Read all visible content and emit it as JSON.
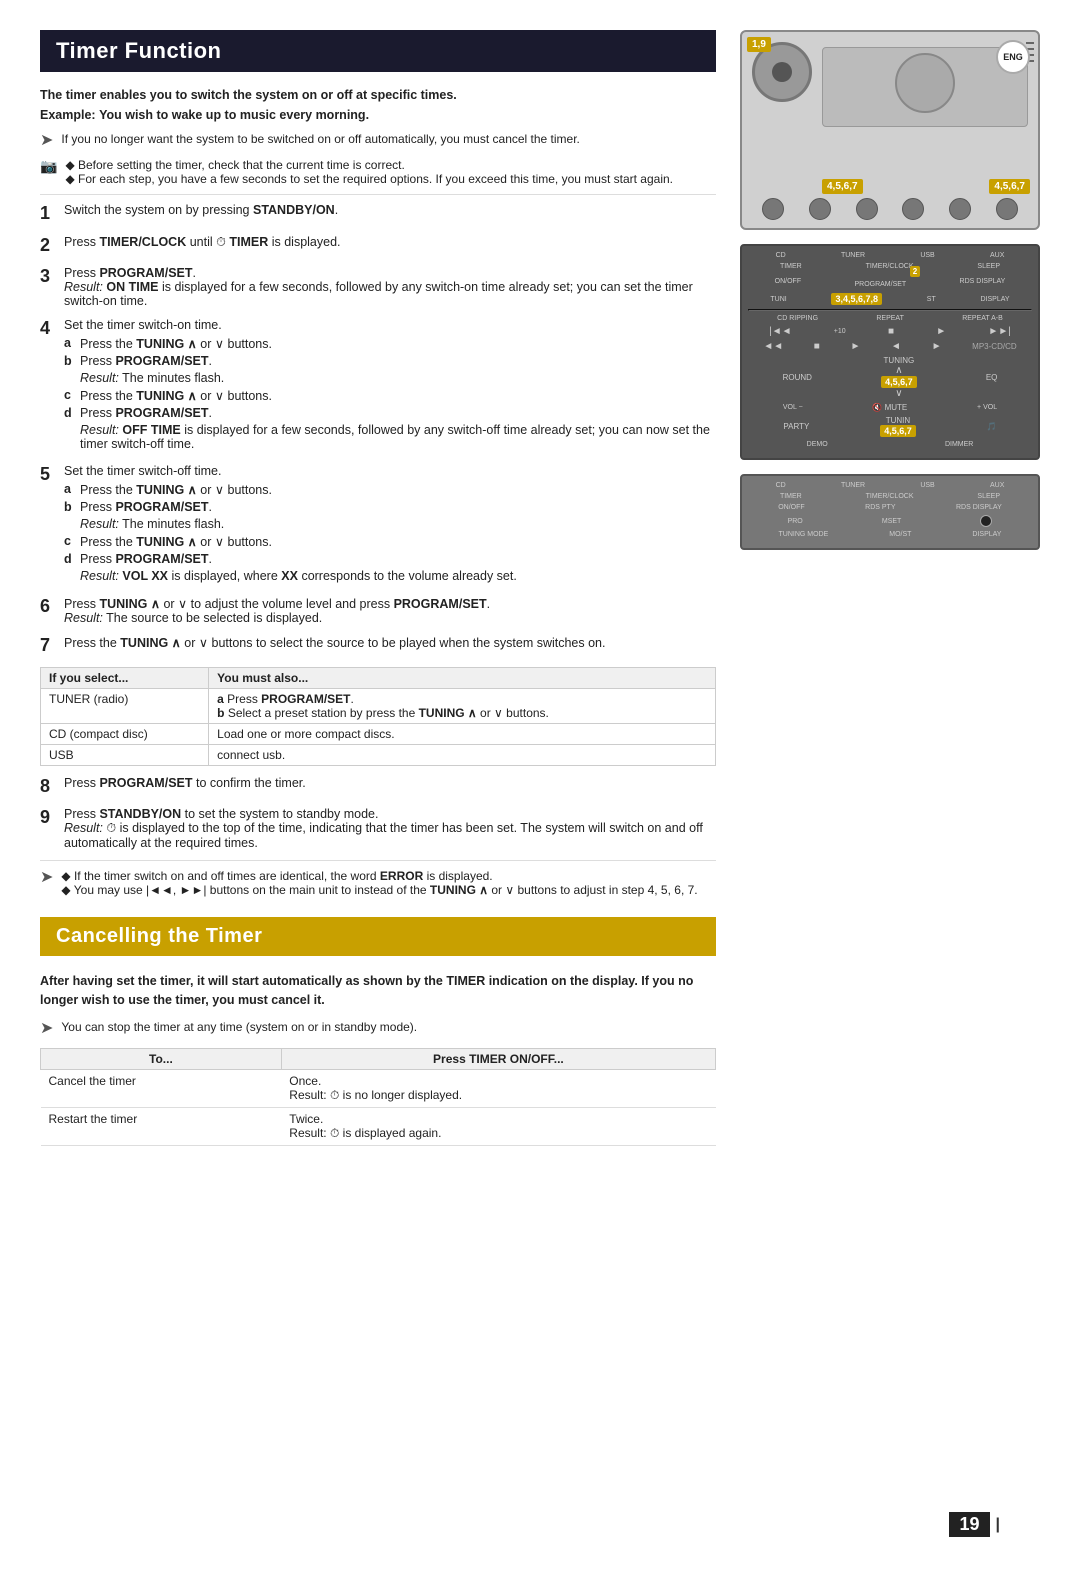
{
  "page": {
    "number": "19",
    "lang_badge": "ENG"
  },
  "timer_section": {
    "title": "Timer Function",
    "intro_bold": "The timer enables you to switch the system on or off at specific times.",
    "intro_example_label": "Example:",
    "intro_example_text": "You wish to wake up to music every morning.",
    "note1": "If you no longer want the system to be switched on or off automatically, you must cancel the timer.",
    "note2a": "◆ Before setting the timer, check that the current time is correct.",
    "note2b": "◆ For each step, you have a few seconds to set the required options. If you exceed this time, you must start again.",
    "steps": [
      {
        "num": "1",
        "text": "Switch the system on by pressing ",
        "bold": "STANDBY/ON",
        "after": "."
      },
      {
        "num": "2",
        "text": "Press ",
        "bold": "TIMER/CLOCK",
        "middle": " until ",
        "icon": "⏱",
        "after_bold": "TIMER",
        "after": " is displayed."
      },
      {
        "num": "3",
        "text": "Press ",
        "bold": "PROGRAM/SET",
        "after": ".",
        "result": "Result:",
        "result_text": " ON TIME is displayed for a few seconds, followed by any switch-on time already set; you can set the timer switch-on time."
      },
      {
        "num": "4",
        "text": "Set the timer switch-on time.",
        "substeps": [
          {
            "letter": "a",
            "text": "Press the ",
            "bold": "TUNING ∧",
            "after": " or ∨ buttons."
          },
          {
            "letter": "b",
            "text": "Press ",
            "bold": "PROGRAM/SET",
            "after": "."
          },
          {
            "letter": "",
            "text": "Result: The minutes flash."
          },
          {
            "letter": "c",
            "text": "Press the ",
            "bold": "TUNING ∧",
            "after": " or ∨ buttons."
          },
          {
            "letter": "d",
            "text": "Press ",
            "bold": "PROGRAM/SET",
            "after": "."
          },
          {
            "letter": "",
            "text": "Result: OFF TIME is displayed for a few seconds, followed by any switch-off time already set; you can now set the timer switch-off time."
          }
        ]
      },
      {
        "num": "5",
        "text": "Set the timer switch-off time.",
        "substeps": [
          {
            "letter": "a",
            "text": "Press the ",
            "bold": "TUNING ∧",
            "after": " or ∨ buttons."
          },
          {
            "letter": "b",
            "text": "Press ",
            "bold": "PROGRAM/SET",
            "after": "."
          },
          {
            "letter": "",
            "text": "Result: The minutes flash."
          },
          {
            "letter": "c",
            "text": "Press the ",
            "bold": "TUNING ∧",
            "after": " or ∨ buttons."
          },
          {
            "letter": "d",
            "text": "Press ",
            "bold": "PROGRAM/SET",
            "after": "."
          },
          {
            "letter": "",
            "text": "Result: VOL XX is displayed, where XX corresponds to the volume already set."
          }
        ]
      },
      {
        "num": "6",
        "text": "Press ",
        "bold": "TUNING ∧",
        "after": " or ∨ to adjust the volume level and press ",
        "bold2": "PROGRAM/SET",
        "after2": ".",
        "result": "Result:",
        "result_text": " The source to be selected is displayed."
      },
      {
        "num": "7",
        "text": "Press the ",
        "bold": "TUNING ∧",
        "after": " or ∨ buttons to select the source to be played when the system switches on."
      }
    ],
    "select_table": {
      "headers": [
        "If you select...",
        "You must also..."
      ],
      "rows": [
        {
          "col1": "TUNER (radio)",
          "col2_items": [
            {
              "letter": "a",
              "text": "Press ",
              "bold": "PROGRAM/SET",
              "after": "."
            },
            {
              "letter": "b",
              "text": "Select a preset station by press the ",
              "bold": "TUNING ∧",
              "after": " or ∨ buttons."
            }
          ]
        },
        {
          "col1": "CD (compact disc)",
          "col2": "Load one or more compact discs."
        },
        {
          "col1": "USB",
          "col2": "connect usb."
        }
      ]
    },
    "step8": {
      "num": "8",
      "text": "Press ",
      "bold": "PROGRAM/SET",
      "after": " to confirm the timer."
    },
    "step9": {
      "num": "9",
      "text": "Press ",
      "bold": "STANDBY/ON",
      "after": " to set the system to standby mode.",
      "result": "Result:",
      "result_text": " ⏱ is displayed to the top of the time, indicating that the timer has been set. The system will switch on and off automatically at the required times."
    },
    "footer_notes": [
      "◆ If the timer switch on and off times are identical, the word ERROR is displayed.",
      "◆ You may use |◄◄, ►►| buttons on the main unit to instead of the TUNING ∧ or ∨ buttons to adjust in step 4, 5, 6, 7."
    ]
  },
  "cancelling_section": {
    "title": "Cancelling the Timer",
    "intro": "After having set the timer, it will start automatically as shown by the TIMER indication on the display. If you no longer wish to use the timer, you must cancel it.",
    "note": "You can stop the timer at any time (system on or in standby mode).",
    "table": {
      "headers": [
        "To...",
        "Press TIMER ON/OFF..."
      ],
      "rows": [
        {
          "action": "Cancel the timer",
          "press": "Once.",
          "result": "Result: ⏱ is no longer displayed."
        },
        {
          "action": "Restart the timer",
          "press": "Twice.",
          "result": "Result: ⏱ is displayed again."
        }
      ]
    }
  },
  "device": {
    "badge1": "1,9",
    "badge2": "4,5,6,7",
    "badge3": "4,5,6,7",
    "badge4": "2",
    "badge5": "3,4,5,6,7,8",
    "badge6": "4,5,6,7",
    "badge7": "4,5,6,7"
  }
}
